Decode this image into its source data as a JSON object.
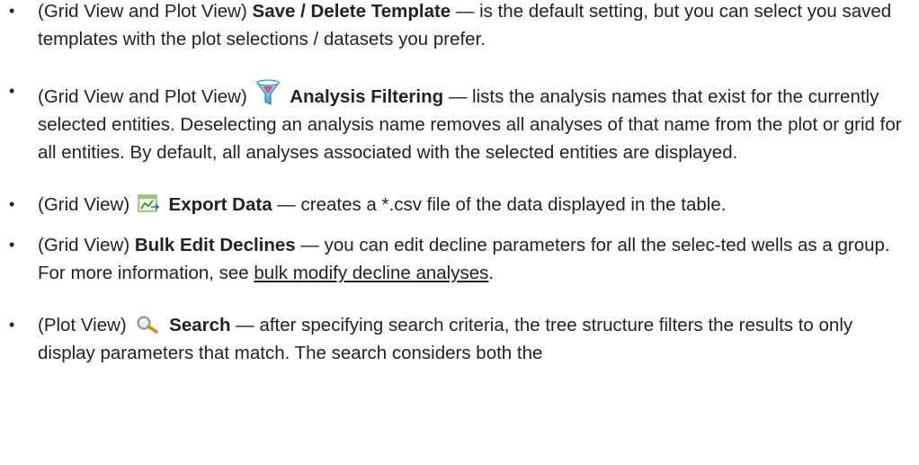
{
  "items": [
    {
      "view": "(Grid View and Plot View)",
      "term": "Save / Delete Template",
      "text": " — is the default setting, but you can select you saved templates with the plot selections / datasets you prefer."
    },
    {
      "view": "(Grid View and Plot View)",
      "icon": "filter-funnel-icon",
      "term": "Analysis Filtering",
      "text": " — lists the analysis names that exist for the currently selected entities. Deselecting an analysis name removes all analyses of that name from the plot or grid for all entities. By default, all analyses associated with the selected entities are displayed."
    },
    {
      "view": "(Grid View)",
      "icon": "export-data-icon",
      "term": "Export Data",
      "text": " — creates a *.csv file of the data displayed in the table."
    },
    {
      "view": "(Grid View)",
      "term": "Bulk Edit Declines",
      "text": " — you can edit decline parameters for all the selec-ted wells as a group. For more information, see ",
      "link": "bulk modify decline analyses",
      "text_after": "."
    },
    {
      "view": "(Plot View)",
      "icon": "search-magnifier-icon",
      "term": "Search",
      "text": " — after specifying search criteria, the tree structure filters the results to only display parameters that match. The search considers both the"
    }
  ]
}
